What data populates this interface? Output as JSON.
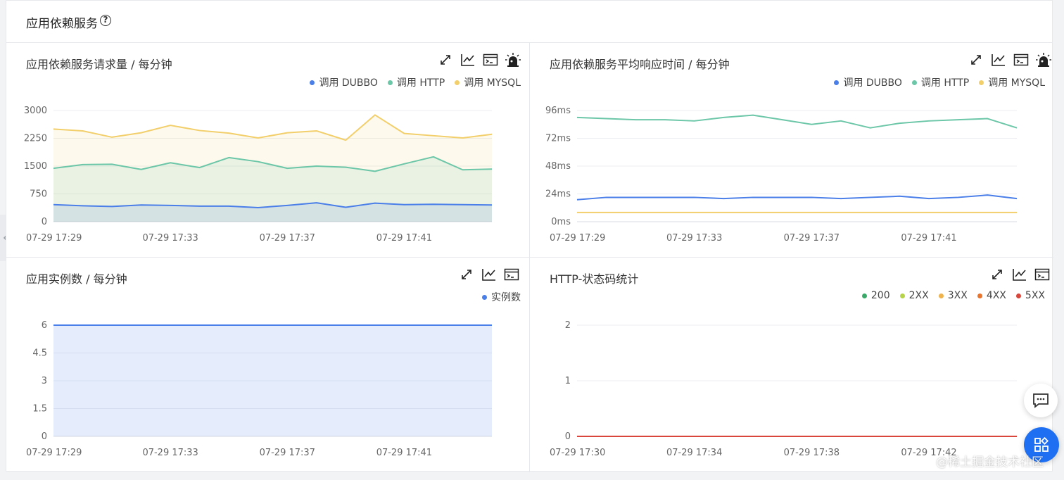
{
  "header": {
    "title": "应用依赖服务"
  },
  "icons": [
    "help-icon",
    "expand-icon",
    "line-chart-icon",
    "terminal-icon",
    "alarm-icon",
    "chevron-left-icon",
    "chat-icon",
    "apps-icon"
  ],
  "watermark": "@稀土掘金技术社区",
  "chart_data": [
    {
      "type": "area",
      "title": "应用依赖服务请求量 / 每分钟",
      "x": [
        "07-29 17:29",
        "07-29 17:30",
        "07-29 17:31",
        "07-29 17:32",
        "07-29 17:33",
        "07-29 17:34",
        "07-29 17:35",
        "07-29 17:36",
        "07-29 17:37",
        "07-29 17:38",
        "07-29 17:39",
        "07-29 17:40",
        "07-29 17:41",
        "07-29 17:42",
        "07-29 17:43",
        "07-29 17:44"
      ],
      "xticks": [
        "07-29 17:29",
        "07-29 17:33",
        "07-29 17:37",
        "07-29 17:41"
      ],
      "yticks": [
        "0",
        "750",
        "1500",
        "2250",
        "3000"
      ],
      "ylim": [
        0,
        3000
      ],
      "grid": true,
      "legend": "top-right",
      "series": [
        {
          "name": "调用 DUBBO",
          "color": "#4a7ee8",
          "values": [
            460,
            430,
            410,
            450,
            440,
            420,
            420,
            380,
            440,
            510,
            390,
            500,
            460,
            470,
            460,
            450
          ]
        },
        {
          "name": "调用 HTTP",
          "color": "#6cc6a8",
          "values": [
            1440,
            1540,
            1550,
            1410,
            1590,
            1460,
            1730,
            1620,
            1440,
            1500,
            1470,
            1360,
            1560,
            1750,
            1400,
            1420
          ]
        },
        {
          "name": "调用 MYSQL",
          "color": "#f2cf6b",
          "values": [
            2500,
            2450,
            2280,
            2400,
            2600,
            2460,
            2390,
            2260,
            2400,
            2450,
            2200,
            2880,
            2380,
            2320,
            2260,
            2360
          ]
        }
      ]
    },
    {
      "type": "line",
      "title": "应用依赖服务平均响应时间 / 每分钟",
      "x": [
        "07-29 17:29",
        "07-29 17:30",
        "07-29 17:31",
        "07-29 17:32",
        "07-29 17:33",
        "07-29 17:34",
        "07-29 17:35",
        "07-29 17:36",
        "07-29 17:37",
        "07-29 17:38",
        "07-29 17:39",
        "07-29 17:40",
        "07-29 17:41",
        "07-29 17:42",
        "07-29 17:43",
        "07-29 17:44"
      ],
      "xticks": [
        "07-29 17:29",
        "07-29 17:33",
        "07-29 17:37",
        "07-29 17:41"
      ],
      "yticks": [
        "0ms",
        "24ms",
        "48ms",
        "72ms",
        "96ms"
      ],
      "ylim": [
        0,
        96
      ],
      "grid": true,
      "legend": "top-right",
      "series": [
        {
          "name": "调用 DUBBO",
          "color": "#4a7ee8",
          "values": [
            19,
            21,
            21,
            21,
            21,
            20,
            21,
            21,
            21,
            20,
            21,
            22,
            20,
            21,
            23,
            20
          ]
        },
        {
          "name": "调用 HTTP",
          "color": "#6cc6a8",
          "values": [
            90,
            89,
            88,
            88,
            87,
            90,
            92,
            88,
            84,
            87,
            81,
            85,
            87,
            88,
            89,
            81
          ]
        },
        {
          "name": "调用 MYSQL",
          "color": "#f2cf6b",
          "values": [
            8,
            8,
            8,
            8,
            8,
            8,
            8,
            8,
            8,
            8,
            8,
            8,
            8,
            8,
            8,
            8
          ]
        }
      ]
    },
    {
      "type": "area",
      "title": "应用实例数 / 每分钟",
      "x": [
        "07-29 17:29",
        "07-29 17:30",
        "07-29 17:31",
        "07-29 17:32",
        "07-29 17:33",
        "07-29 17:34",
        "07-29 17:35",
        "07-29 17:36",
        "07-29 17:37",
        "07-29 17:38",
        "07-29 17:39",
        "07-29 17:40",
        "07-29 17:41",
        "07-29 17:42",
        "07-29 17:43",
        "07-29 17:44"
      ],
      "xticks": [
        "07-29 17:29",
        "07-29 17:33",
        "07-29 17:37",
        "07-29 17:41"
      ],
      "yticks": [
        "0",
        "1.5",
        "3",
        "4.5",
        "6"
      ],
      "ylim": [
        0,
        6
      ],
      "grid": true,
      "legend": "top-right",
      "series": [
        {
          "name": "实例数",
          "color": "#4a7ee8",
          "values": [
            6,
            6,
            6,
            6,
            6,
            6,
            6,
            6,
            6,
            6,
            6,
            6,
            6,
            6,
            6,
            6
          ]
        }
      ]
    },
    {
      "type": "line",
      "title": "HTTP-状态码统计",
      "x": [
        "07-29 17:30",
        "07-29 17:31",
        "07-29 17:32",
        "07-29 17:33",
        "07-29 17:34",
        "07-29 17:35",
        "07-29 17:36",
        "07-29 17:37",
        "07-29 17:38",
        "07-29 17:39",
        "07-29 17:40",
        "07-29 17:41",
        "07-29 17:42",
        "07-29 17:43",
        "07-29 17:44",
        "07-29 17:45"
      ],
      "xticks": [
        "07-29 17:30",
        "07-29 17:34",
        "07-29 17:38",
        "07-29 17:42"
      ],
      "yticks": [
        "0",
        "1",
        "2"
      ],
      "ylim": [
        0,
        2
      ],
      "grid": true,
      "legend": "top-right",
      "series": [
        {
          "name": "200",
          "color": "#3aa868",
          "values": [
            0,
            0,
            0,
            0,
            0,
            0,
            0,
            0,
            0,
            0,
            0,
            0,
            0,
            0,
            0,
            0
          ]
        },
        {
          "name": "2XX",
          "color": "#b7d34a",
          "values": [
            0,
            0,
            0,
            0,
            0,
            0,
            0,
            0,
            0,
            0,
            0,
            0,
            0,
            0,
            0,
            0
          ]
        },
        {
          "name": "3XX",
          "color": "#f0b24a",
          "values": [
            0,
            0,
            0,
            0,
            0,
            0,
            0,
            0,
            0,
            0,
            0,
            0,
            0,
            0,
            0,
            0
          ]
        },
        {
          "name": "4XX",
          "color": "#e8752e",
          "values": [
            0,
            0,
            0,
            0,
            0,
            0,
            0,
            0,
            0,
            0,
            0,
            0,
            0,
            0,
            0,
            0
          ]
        },
        {
          "name": "5XX",
          "color": "#d9463b",
          "values": [
            0,
            0,
            0,
            0,
            0,
            0,
            0,
            0,
            0,
            0,
            0,
            0,
            0,
            0,
            0,
            0
          ]
        }
      ]
    }
  ]
}
